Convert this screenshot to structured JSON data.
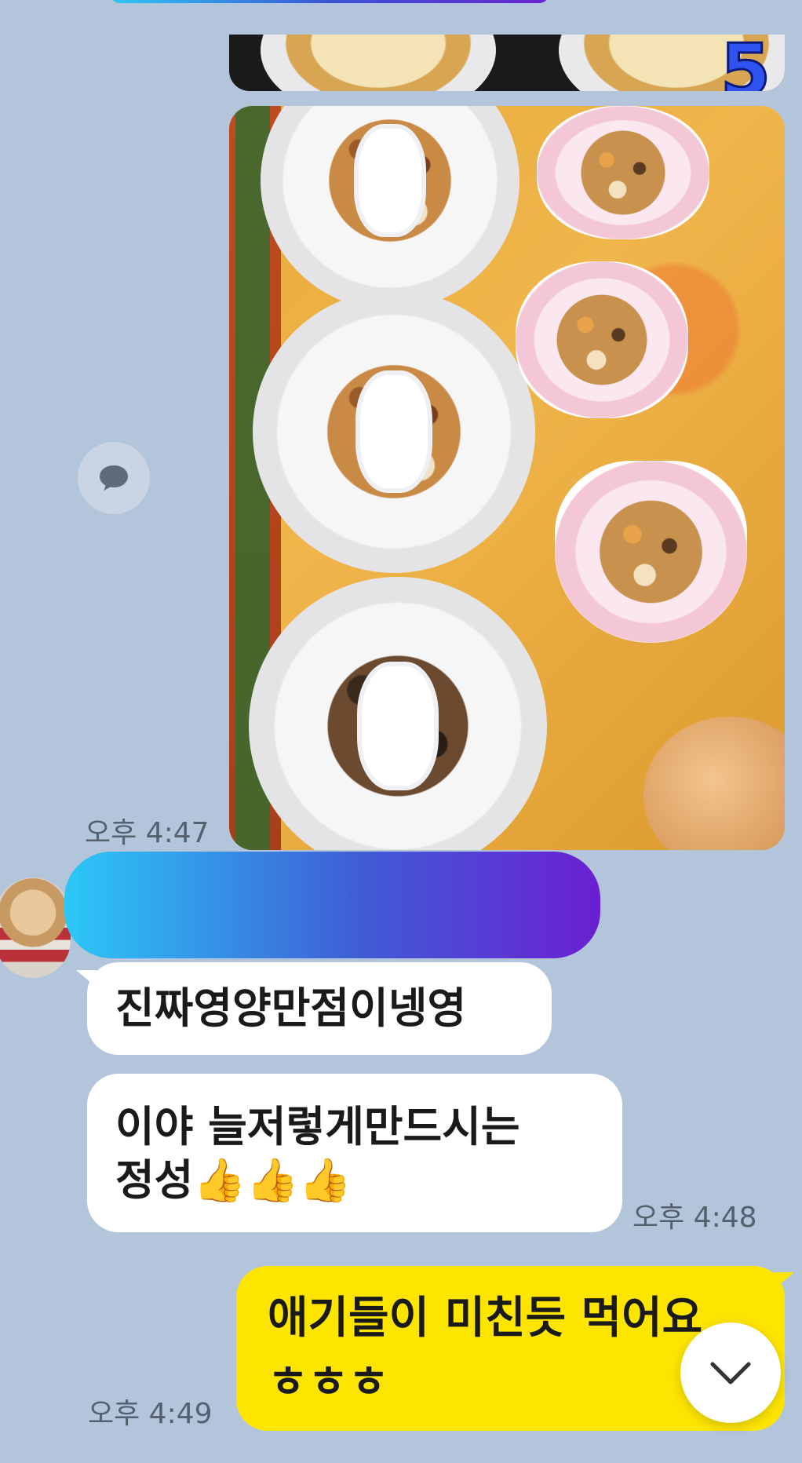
{
  "photos": {
    "batch_number": "5"
  },
  "messages": {
    "photo_time": "오후 4:47",
    "incoming_1": "진짜영양만점이넹영",
    "incoming_2_line1": "이야 늘저렇게만드시는",
    "incoming_2_line2": "정성",
    "incoming_2_emoji": "👍👍👍",
    "incoming_time": "오후 4:48",
    "outgoing_line1": "애기들이 미친듯 먹어요",
    "outgoing_line2": "ㅎㅎㅎ",
    "outgoing_time": "오후 4:49"
  },
  "icons": {
    "comment": "speech-bubble-icon",
    "scroll_down": "chevron-down-icon"
  },
  "colors": {
    "background": "#b3c5db",
    "outgoing_bubble": "#fee500",
    "incoming_bubble": "#ffffff",
    "name_gradient_start": "#2cc8f7",
    "name_gradient_end": "#6b1fd2"
  }
}
